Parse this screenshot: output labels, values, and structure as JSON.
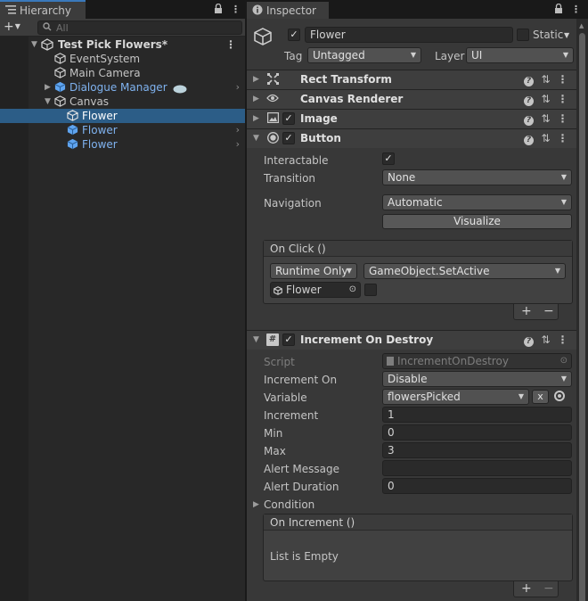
{
  "hierarchy": {
    "tab_label": "Hierarchy",
    "search_placeholder": "All",
    "items": [
      {
        "label": "Test Pick Flowers*"
      },
      {
        "label": "EventSystem"
      },
      {
        "label": "Main Camera"
      },
      {
        "label": "Dialogue Manager"
      },
      {
        "label": "Canvas"
      },
      {
        "label": "Flower"
      },
      {
        "label": "Flower"
      },
      {
        "label": "Flower"
      }
    ]
  },
  "inspector": {
    "tab_label": "Inspector",
    "object_name": "Flower",
    "static_label": "Static",
    "tag_label": "Tag",
    "tag_value": "Untagged",
    "layer_label": "Layer",
    "layer_value": "UI",
    "components": {
      "rect_transform": "Rect Transform",
      "canvas_renderer": "Canvas Renderer",
      "image": "Image",
      "button": "Button",
      "increment": "Increment On Destroy"
    },
    "button": {
      "interactable_label": "Interactable",
      "transition_label": "Transition",
      "transition_value": "None",
      "navigation_label": "Navigation",
      "navigation_value": "Automatic",
      "visualize_label": "Visualize",
      "onclick_label": "On Click ()",
      "runtime_value": "Runtime Only",
      "function_value": "GameObject.SetActive",
      "target_object": "Flower"
    },
    "increment": {
      "script_label": "Script",
      "script_value": "IncrementOnDestroy",
      "increment_on_label": "Increment On",
      "increment_on_value": "Disable",
      "variable_label": "Variable",
      "variable_value": "flowersPicked",
      "x_label": "x",
      "increment_label": "Increment",
      "increment_value": "1",
      "min_label": "Min",
      "min_value": "0",
      "max_label": "Max",
      "max_value": "3",
      "alert_message_label": "Alert Message",
      "alert_message_value": "",
      "alert_duration_label": "Alert Duration",
      "alert_duration_value": "0",
      "condition_label": "Condition",
      "on_increment_label": "On Increment ()",
      "list_empty_label": "List is Empty"
    }
  },
  "colors": {
    "selection": "#2c5d87",
    "prefab_blue": "#7fb2ef",
    "tab_accent": "#3a79bb"
  }
}
